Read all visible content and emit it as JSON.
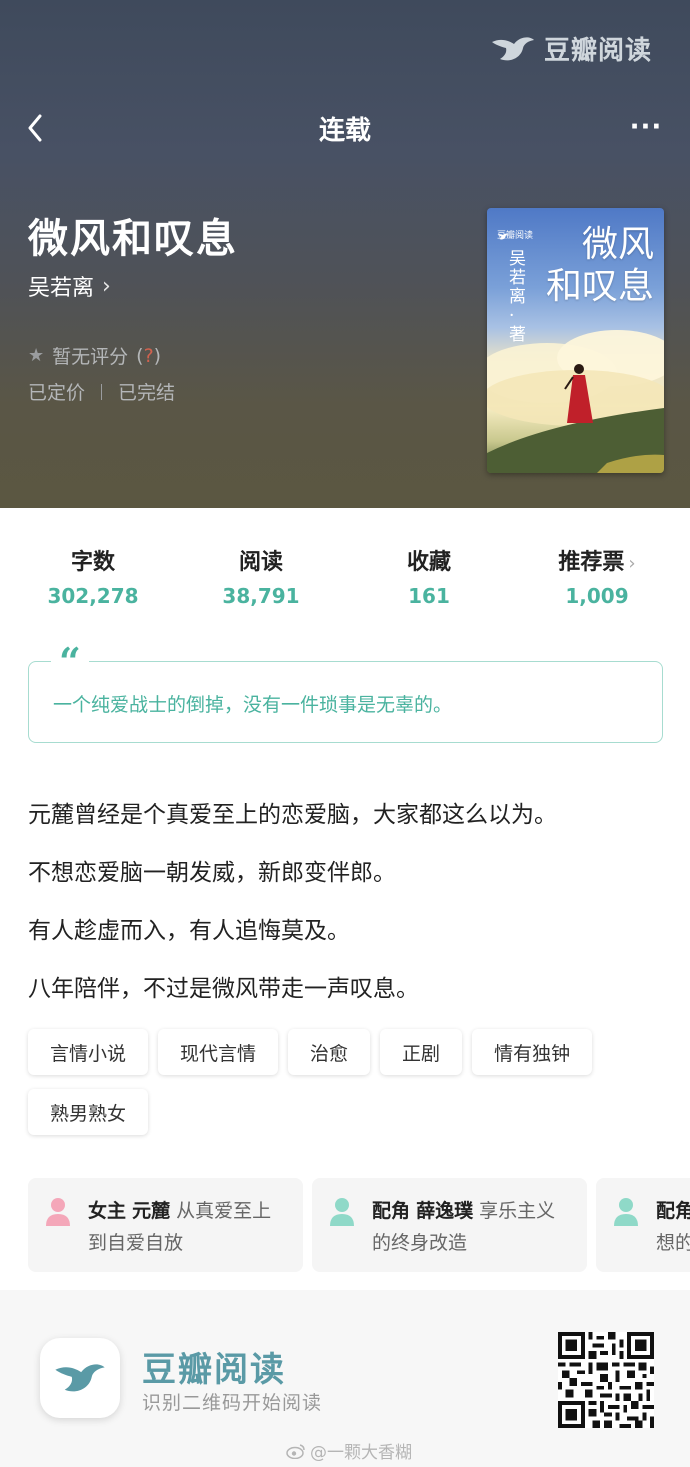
{
  "brand": {
    "name": "豆瓣阅读"
  },
  "nav": {
    "title": "连载",
    "more": "···"
  },
  "book": {
    "title": "微风和叹息",
    "author": "吴若离",
    "rating_text": "暂无评分",
    "rating_help": "?",
    "status_priced": "已定价",
    "status_finished": "已完结"
  },
  "cover": {
    "brand": "豆瓣阅读",
    "title_line1": "微风",
    "title_line2": "和叹息",
    "author": "吴若离·著"
  },
  "stats": [
    {
      "label": "字数",
      "value": "302,278"
    },
    {
      "label": "阅读",
      "value": "38,791"
    },
    {
      "label": "收藏",
      "value": "161"
    },
    {
      "label": "推荐票",
      "value": "1,009"
    }
  ],
  "quote": {
    "mark": "“",
    "text": "一个纯爱战士的倒掉，没有一件琐事是无辜的。"
  },
  "description": [
    "元麓曾经是个真爱至上的恋爱脑，大家都这么以为。",
    "不想恋爱脑一朝发威，新郎变伴郎。",
    "有人趁虚而入，有人追悔莫及。",
    "八年陪伴，不过是微风带走一声叹息。"
  ],
  "tags": [
    "言情小说",
    "现代言情",
    "治愈",
    "正剧",
    "情有独钟",
    "熟男熟女"
  ],
  "roles": [
    {
      "role": "女主",
      "name": "元麓",
      "desc": "从真爱至上到自爱自放",
      "color": "#f4a7b9"
    },
    {
      "role": "配角",
      "name": "薛逸璞",
      "desc": "享乐主义的终身改造",
      "color": "#8fd9c8"
    },
    {
      "role": "配角",
      "name": "",
      "desc": "想的",
      "color": "#8fd9c8"
    }
  ],
  "footer": {
    "name": "豆瓣阅读",
    "subtitle": "识别二维码开始阅读",
    "watermark": "@一颗大香糊"
  },
  "colors": {
    "accent": "#4ab39f",
    "brand": "#5a9aa6",
    "female": "#f4a7b9",
    "male": "#8fd9c8"
  }
}
